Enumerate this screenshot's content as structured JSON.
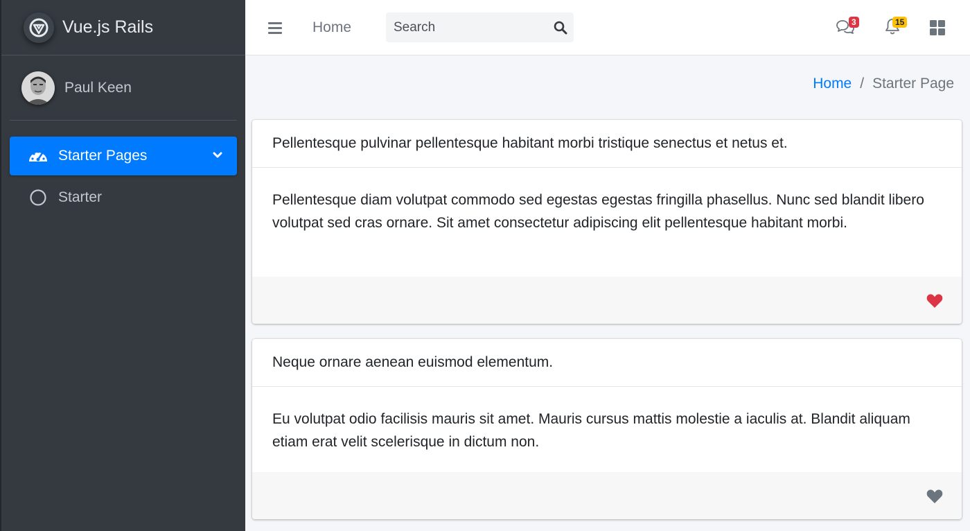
{
  "brand": {
    "name": "Vue.js Rails",
    "logo_icon": "vue-rails-logo-icon"
  },
  "user": {
    "name": "Paul Keen"
  },
  "sidebar": {
    "items": [
      {
        "label": "Starter Pages",
        "icon": "tachometer-icon",
        "active": true,
        "caret": "chevron-down-icon"
      },
      {
        "label": "Starter",
        "icon": "circle-icon",
        "active": false
      }
    ]
  },
  "header": {
    "menu_icon": "hamburger-icon",
    "home_label": "Home",
    "search": {
      "placeholder": "Search",
      "value": ""
    },
    "messages_badge": "3",
    "notifications_badge": "15",
    "apps_icon": "grid-icon"
  },
  "breadcrumb": {
    "home": "Home",
    "separator": "/",
    "current": "Starter Page"
  },
  "cards": [
    {
      "title": "Pellentesque pulvinar pellentesque habitant morbi tristique senectus et netus et.",
      "body": "Pellentesque diam volutpat commodo sed egestas egestas fringilla phasellus. Nunc sed blandit libero volutpat sed cras ornare. Sit amet consectetur adipiscing elit pellentesque habitant morbi.",
      "liked": true,
      "heart_color": "#dc3545"
    },
    {
      "title": "Neque ornare aenean euismod elementum.",
      "body": "Eu volutpat odio facilisis mauris sit amet. Mauris cursus mattis molestie a iaculis at. Blandit aliquam etiam erat velit scelerisque in dictum non.",
      "liked": false,
      "heart_color": "#6c757d"
    }
  ],
  "colors": {
    "primary": "#007bff",
    "sidebar_bg": "#343a40",
    "danger": "#dc3545",
    "warning": "#ffc107"
  }
}
